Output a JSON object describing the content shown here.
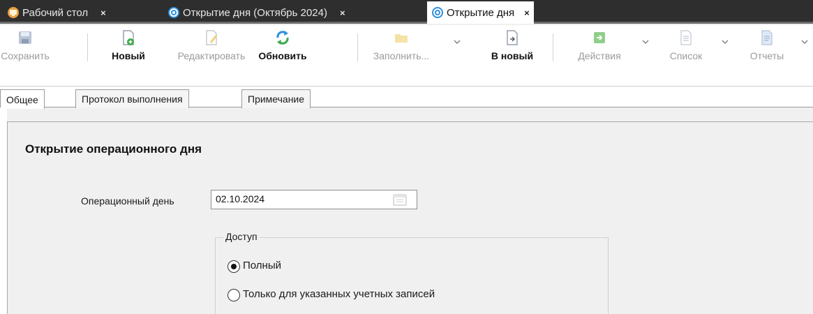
{
  "doc_tabs": [
    {
      "label": "Рабочий стол",
      "icon": "desktop-icon",
      "close": "×"
    },
    {
      "label": "Открытие дня (Октябрь 2024)",
      "icon": "day-open-icon",
      "close": "×"
    },
    {
      "label": "Открытие дня",
      "icon": "day-open-icon",
      "close": "×",
      "active": true
    }
  ],
  "toolbar": {
    "save": "Сохранить",
    "new": "Новый",
    "edit": "Редактировать",
    "refresh": "Обновить",
    "fill": "Заполнить...",
    "to_new": "В новый",
    "actions": "Действия",
    "list": "Список",
    "reports": "Отчеты"
  },
  "inner_tabs": [
    "Общее",
    "Протокол выполнения",
    "Примечание"
  ],
  "form": {
    "title": "Открытие операционного дня",
    "date_label": "Операционный день",
    "date_value": "02.10.2024",
    "access_group": "Доступ",
    "access_options": [
      "Полный",
      "Только для указанных учетных записей"
    ],
    "access_selected": 0
  },
  "colors": {
    "tabbar_bg": "#2e2e2e",
    "accent_blue": "#2f8fde",
    "icon_green": "#3aa84a",
    "disabled_text": "#9a9a9a"
  }
}
